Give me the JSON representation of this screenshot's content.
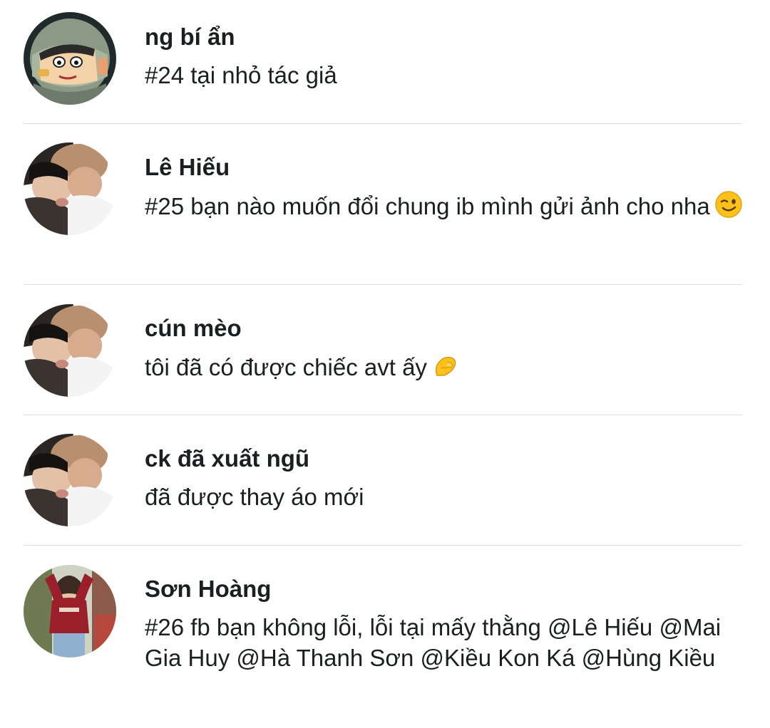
{
  "comments": [
    {
      "author": "ng bí ẩn",
      "avatar_icon": "cartoon-boy-avatar",
      "text": "#24 tại nhỏ tác giả"
    },
    {
      "author": "Lê Hiếu",
      "avatar_icon": "couple-photo-avatar",
      "text": "#25 bạn nào muốn đổi chung ib mình gửi ảnh cho nha",
      "emoji": "winking-face-emoji"
    },
    {
      "author": "cún mèo",
      "avatar_icon": "couple-photo-avatar",
      "text": "tôi đã có được chiếc avt ấy",
      "emoji": "pinching-hand-emoji"
    },
    {
      "author": "ck đã xuất ngũ",
      "avatar_icon": "couple-photo-avatar",
      "text": "đã được thay áo mới"
    },
    {
      "author": "Sơn Hoàng",
      "avatar_icon": "girl-in-red-sweater-avatar",
      "text": "#26 fb bạn không lỗi, lỗi tại mấy thằng @Lê Hiếu @Mai Gia Huy @Hà Thanh Sơn @Kiều Kon Ká @Hùng Kiều"
    }
  ],
  "colors": {
    "text": "#1c1e21",
    "divider": "#dadde1",
    "background": "#ffffff"
  }
}
